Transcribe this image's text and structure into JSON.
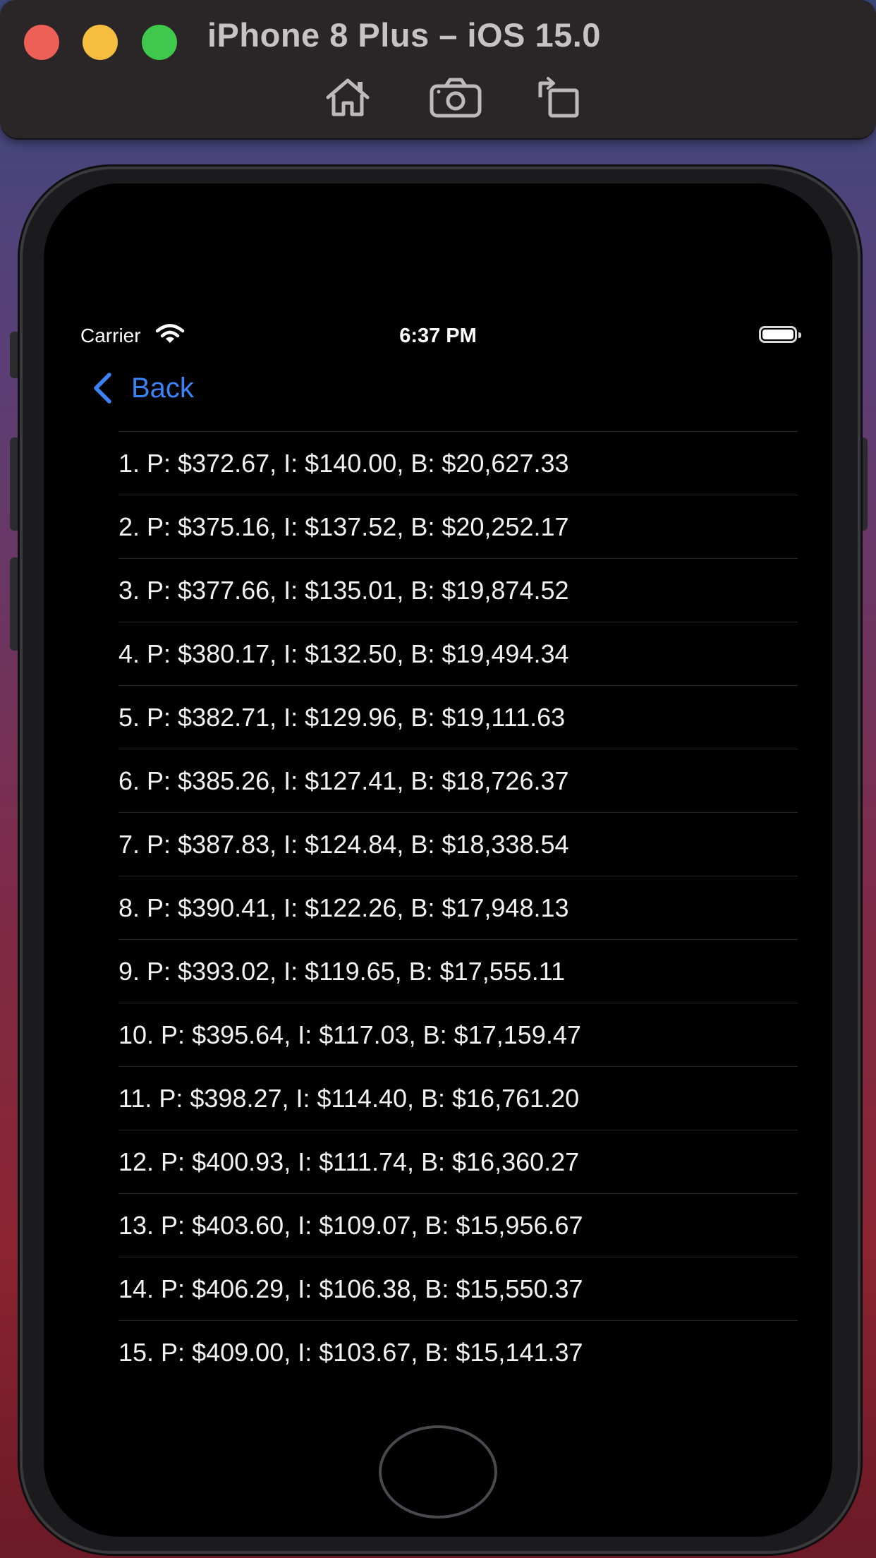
{
  "window": {
    "title": "iPhone 8 Plus – iOS 15.0",
    "toolbar_icons": [
      "home-icon",
      "screenshot-icon",
      "rotate-icon"
    ]
  },
  "status_bar": {
    "carrier": "Carrier",
    "time": "6:37 PM"
  },
  "nav": {
    "back_label": "Back"
  },
  "colors": {
    "accent": "#3b82f6",
    "background": "#000000",
    "text": "#f2f2f2"
  },
  "rows": [
    "1. P: $372.67, I: $140.00, B: $20,627.33",
    "2. P: $375.16, I: $137.52, B: $20,252.17",
    "3. P: $377.66, I: $135.01, B: $19,874.52",
    "4. P: $380.17, I: $132.50, B: $19,494.34",
    "5. P: $382.71, I: $129.96, B: $19,111.63",
    "6. P: $385.26, I: $127.41, B: $18,726.37",
    "7. P: $387.83, I: $124.84, B: $18,338.54",
    "8. P: $390.41, I: $122.26, B: $17,948.13",
    "9. P: $393.02, I: $119.65, B: $17,555.11",
    "10. P: $395.64, I: $117.03, B: $17,159.47",
    "11. P: $398.27, I: $114.40, B: $16,761.20",
    "12. P: $400.93, I: $111.74, B: $16,360.27",
    "13. P: $403.60, I: $109.07, B: $15,956.67",
    "14. P: $406.29, I: $106.38, B: $15,550.37",
    "15. P: $409.00, I: $103.67, B: $15,141.37"
  ]
}
